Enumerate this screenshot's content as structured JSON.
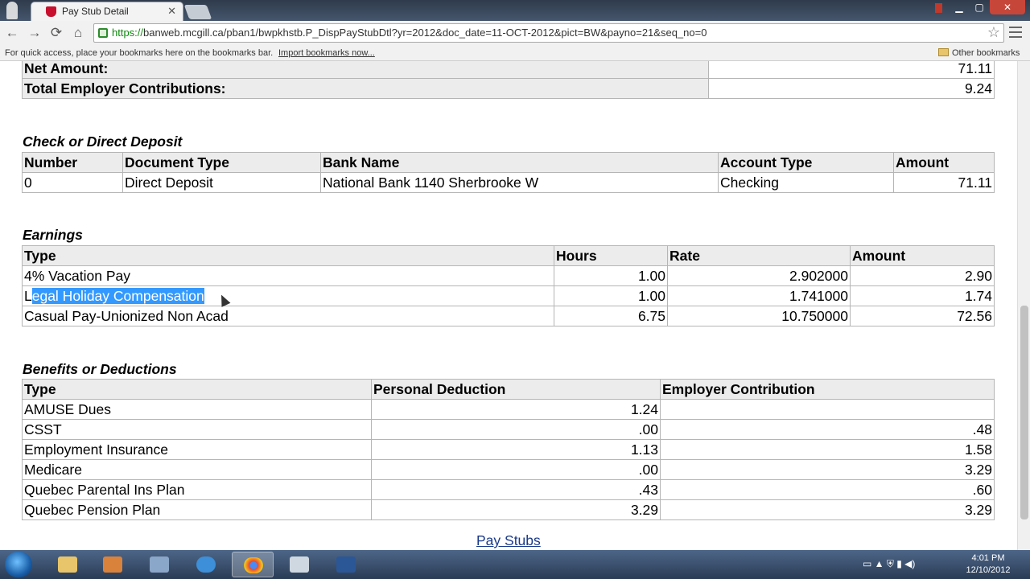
{
  "browser": {
    "tab_title": "Pay Stub Detail",
    "tab_close": "✕",
    "url_scheme": "https://",
    "url_rest": "banweb.mcgill.ca/pban1/bwpkhstb.P_DispPayStubDtl?yr=2012&doc_date=11-OCT-2012&pict=BW&payno=21&seq_no=0",
    "bookmarks_hint": "For quick access, place your bookmarks here on the bookmarks bar.",
    "import_link": "Import bookmarks now...",
    "other_bookmarks": "Other bookmarks",
    "nav": {
      "back": "←",
      "forward": "→",
      "reload": "⟳",
      "home": "⌂",
      "star": "☆",
      "minimize": "▁",
      "maximize": "▢",
      "close": "✕"
    }
  },
  "totals": [
    {
      "label": "Net Amount:",
      "value": "71.11"
    },
    {
      "label": "Total Employer Contributions:",
      "value": "9.24"
    }
  ],
  "deposit": {
    "caption": "Check or Direct Deposit",
    "headers": [
      "Number",
      "Document Type",
      "Bank Name",
      "Account Type",
      "Amount"
    ],
    "rows": [
      [
        "0",
        "Direct Deposit",
        "National Bank 1140 Sherbrooke W",
        "Checking",
        "71.11"
      ]
    ]
  },
  "earnings": {
    "caption": "Earnings",
    "headers": [
      "Type",
      "Hours",
      "Rate",
      "Amount"
    ],
    "rows": [
      {
        "type": "4% Vacation Pay",
        "hours": "1.00",
        "rate": "2.902000",
        "amount": "2.90"
      },
      {
        "type_first": "L",
        "type_selected": "egal Holiday Compensation",
        "hours": "1.00",
        "rate": "1.741000",
        "amount": "1.74"
      },
      {
        "type": "Casual Pay-Unionized Non Acad",
        "hours": "6.75",
        "rate": "10.750000",
        "amount": "72.56"
      }
    ]
  },
  "benefits": {
    "caption": "Benefits or Deductions",
    "headers": [
      "Type",
      "Personal Deduction",
      "Employer Contribution"
    ],
    "rows": [
      [
        "AMUSE Dues",
        "1.24",
        ""
      ],
      [
        "CSST",
        ".00",
        ".48"
      ],
      [
        "Employment Insurance",
        "1.13",
        "1.58"
      ],
      [
        "Medicare",
        ".00",
        "3.29"
      ],
      [
        "Quebec Parental Ins Plan",
        ".43",
        ".60"
      ],
      [
        "Quebec Pension Plan",
        "3.29",
        "3.29"
      ]
    ]
  },
  "footer_link": "Pay Stubs",
  "taskbar": {
    "apps": [
      "explorer-icon",
      "media-player-icon",
      "network-icon",
      "internet-explorer-icon",
      "chrome-icon",
      "notepad-icon",
      "word-icon"
    ],
    "time": "4:01 PM",
    "date": "12/10/2012",
    "tray_icons": "▭  ▲  ⛨  ▮  ◀)"
  }
}
